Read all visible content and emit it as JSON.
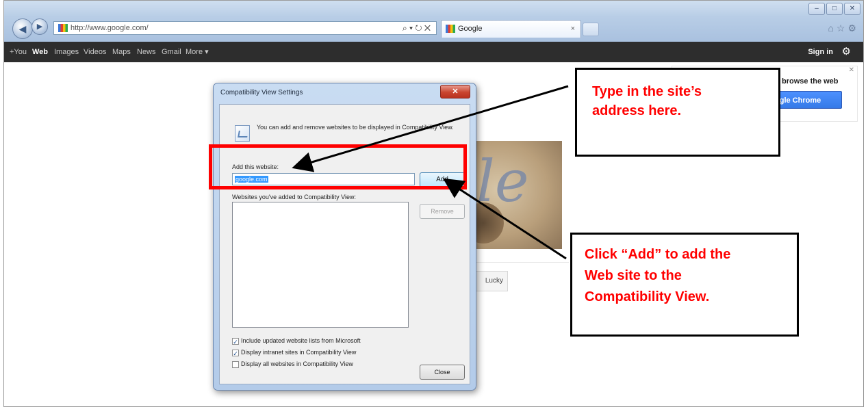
{
  "browser": {
    "address_url": "http://www.google.com/",
    "address_tools": "⌕ ▾ ↻ ✕",
    "tab_label": "Google",
    "tab_close": "×",
    "right_icons": "⌂☆⚙"
  },
  "google_bar": {
    "items": [
      "+You",
      "Web",
      "Images",
      "Videos",
      "Maps",
      "News",
      "Gmail",
      "More ▾"
    ],
    "signin": "Sign in",
    "gear": "⚙"
  },
  "promo": {
    "text": "browse the web",
    "button": "gle Chrome",
    "close": "✕"
  },
  "page": {
    "lucky": "Lucky",
    "doodle": "le"
  },
  "dialog": {
    "title": "Compatibility View Settings",
    "close": "✕",
    "info_text": "You can add and remove websites to be displayed in Compatibility View.",
    "add_label": "Add this website:",
    "input_value": "google.com",
    "add_button": "Add",
    "list_label": "Websites you've added to Compatibility View:",
    "remove_button": "Remove",
    "checkboxes": [
      {
        "label": "Include updated website lists from Microsoft",
        "checked": true,
        "mark": "✓"
      },
      {
        "label": "Display intranet sites in Compatibility View",
        "checked": true,
        "mark": "✓"
      },
      {
        "label": "Display all websites in Compatibility View",
        "checked": false,
        "mark": ""
      }
    ],
    "close_button": "Close"
  },
  "annotations": {
    "callout_1": [
      "Type in the site’s",
      "address here."
    ],
    "callout_2": [
      "Click “Add” to add the",
      "Web site to the",
      "Compatibility View."
    ],
    "highlight_color": "#ff0000",
    "callout_text_color": "#ff0000"
  }
}
